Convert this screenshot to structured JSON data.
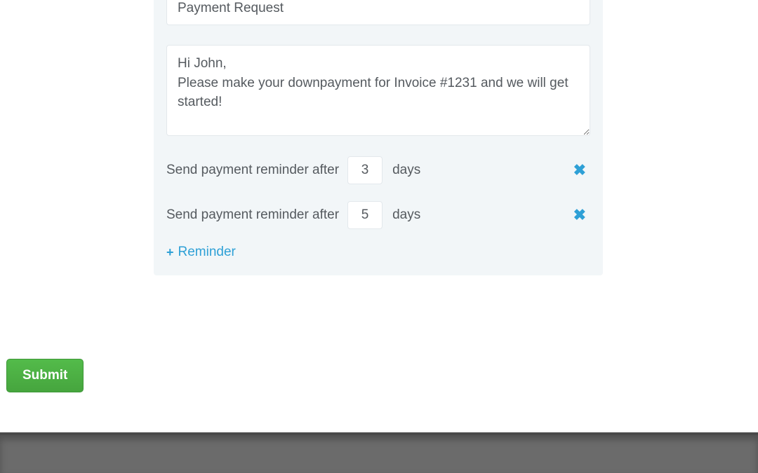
{
  "form": {
    "subject": "Payment Request",
    "message": "Hi John,\nPlease make your downpayment for Invoice #1231 and we will get started!",
    "reminders": [
      {
        "label_before": "Send payment reminder after",
        "days": "3",
        "label_after": "days"
      },
      {
        "label_before": "Send payment reminder after",
        "days": "5",
        "label_after": "days"
      }
    ],
    "add_reminder_label": "Reminder"
  },
  "actions": {
    "submit_label": "Submit"
  }
}
